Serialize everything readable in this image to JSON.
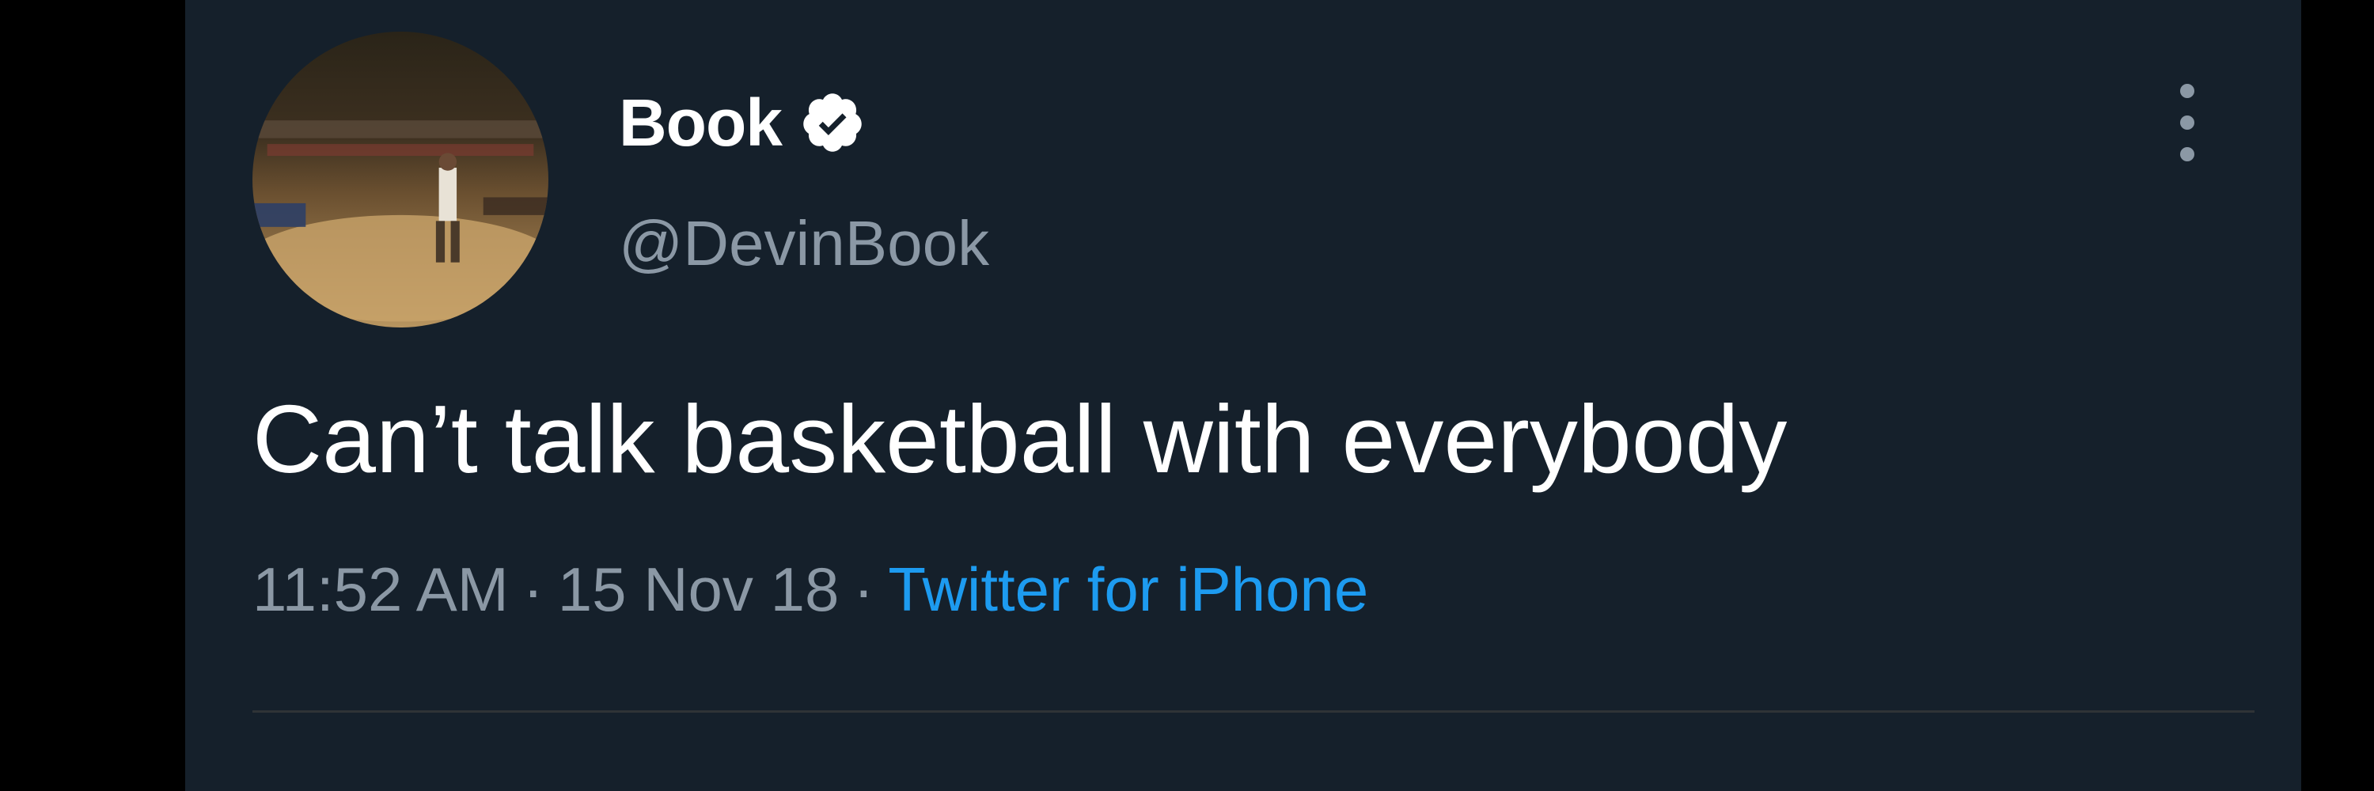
{
  "colors": {
    "background": "#15202b",
    "outer_background": "#000000",
    "primary_text": "#ffffff",
    "secondary_text": "#8b98a5",
    "link": "#1d9bf0",
    "divider": "#2f3336"
  },
  "tweet": {
    "author": {
      "display_name": "Book",
      "handle": "@DevinBook",
      "verified": true,
      "avatar_icon": "profile-photo-basketball-court"
    },
    "text": "Can’t talk basketball with everybody",
    "meta": {
      "time": "11:52 AM",
      "date": "15 Nov 18",
      "separator": "·",
      "source": "Twitter for iPhone"
    },
    "more_icon": "more-vertical-icon"
  }
}
